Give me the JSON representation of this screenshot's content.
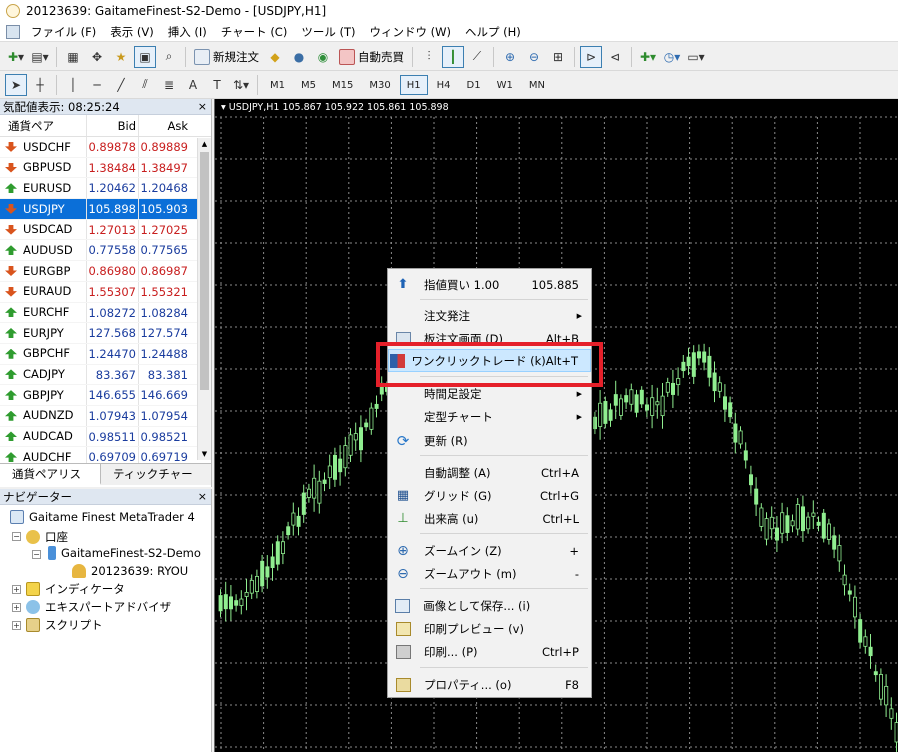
{
  "window": {
    "title": "20123639: GaitameFinest-S2-Demo - [USDJPY,H1]"
  },
  "menu": [
    "ファイル (F)",
    "表示 (V)",
    "挿入 (I)",
    "チャート (C)",
    "ツール (T)",
    "ウィンドウ (W)",
    "ヘルプ (H)"
  ],
  "toolbar": {
    "new_order": "新規注文",
    "auto_trade": "自動売買"
  },
  "timeframes": [
    "M1",
    "M5",
    "M15",
    "M30",
    "H1",
    "H4",
    "D1",
    "W1",
    "MN"
  ],
  "text_tools": {
    "text": "A",
    "label": "T"
  },
  "market_watch": {
    "title": "気配値表示: 08:25:24",
    "col_pair": "通貨ペア",
    "col_bid": "Bid",
    "col_ask": "Ask",
    "rows": [
      {
        "pair": "USDCHF",
        "bid": "0.89878",
        "ask": "0.89889",
        "dir": "dn"
      },
      {
        "pair": "GBPUSD",
        "bid": "1.38484",
        "ask": "1.38497",
        "dir": "dn"
      },
      {
        "pair": "EURUSD",
        "bid": "1.20462",
        "ask": "1.20468",
        "dir": "up"
      },
      {
        "pair": "USDJPY",
        "bid": "105.898",
        "ask": "105.903",
        "dir": "dn"
      },
      {
        "pair": "USDCAD",
        "bid": "1.27013",
        "ask": "1.27025",
        "dir": "dn"
      },
      {
        "pair": "AUDUSD",
        "bid": "0.77558",
        "ask": "0.77565",
        "dir": "up"
      },
      {
        "pair": "EURGBP",
        "bid": "0.86980",
        "ask": "0.86987",
        "dir": "dn"
      },
      {
        "pair": "EURAUD",
        "bid": "1.55307",
        "ask": "1.55321",
        "dir": "dn"
      },
      {
        "pair": "EURCHF",
        "bid": "1.08272",
        "ask": "1.08284",
        "dir": "up"
      },
      {
        "pair": "EURJPY",
        "bid": "127.568",
        "ask": "127.574",
        "dir": "up"
      },
      {
        "pair": "GBPCHF",
        "bid": "1.24470",
        "ask": "1.24488",
        "dir": "up"
      },
      {
        "pair": "CADJPY",
        "bid": "83.367",
        "ask": "83.381",
        "dir": "up"
      },
      {
        "pair": "GBPJPY",
        "bid": "146.655",
        "ask": "146.669",
        "dir": "up"
      },
      {
        "pair": "AUDNZD",
        "bid": "1.07943",
        "ask": "1.07954",
        "dir": "up"
      },
      {
        "pair": "AUDCAD",
        "bid": "0.98511",
        "ask": "0.98521",
        "dir": "up"
      },
      {
        "pair": "AUDCHF",
        "bid": "0.69709",
        "ask": "0.69719",
        "dir": "up"
      }
    ],
    "tab_pairs": "通貨ペアリスト",
    "tab_tick": "ティックチャート"
  },
  "navigator": {
    "title": "ナビゲーター",
    "root": "Gaitame Finest MetaTrader 4",
    "accounts": "口座",
    "server": "GaitameFinest-S2-Demo",
    "account": "20123639: RYOU",
    "indicators": "インディケータ",
    "experts": "エキスパートアドバイザ",
    "scripts": "スクリプト"
  },
  "chart": {
    "header": "USDJPY,H1  105.867 105.922 105.861 105.898"
  },
  "context_menu": {
    "items": [
      {
        "label": "指値買い 1.00",
        "shortcut": "105.885"
      },
      {
        "label": "注文発注",
        "shortcut": ""
      },
      {
        "label": "板注文画面 (D)",
        "shortcut": "Alt+B"
      },
      {
        "label": "ワンクリックトレード (k)",
        "shortcut": "Alt+T"
      },
      {
        "label": "時間足設定",
        "shortcut": ""
      },
      {
        "label": "定型チャート",
        "shortcut": ""
      },
      {
        "label": "更新 (R)",
        "shortcut": ""
      },
      {
        "label": "自動調整 (A)",
        "shortcut": "Ctrl+A"
      },
      {
        "label": "グリッド (G)",
        "shortcut": "Ctrl+G"
      },
      {
        "label": "出来高 (u)",
        "shortcut": "Ctrl+L"
      },
      {
        "label": "ズームイン (Z)",
        "shortcut": "+"
      },
      {
        "label": "ズームアウト (m)",
        "shortcut": "-"
      },
      {
        "label": "画像として保存... (i)",
        "shortcut": ""
      },
      {
        "label": "印刷プレビュー (v)",
        "shortcut": ""
      },
      {
        "label": "印刷... (P)",
        "shortcut": "Ctrl+P"
      },
      {
        "label": "プロパティ... (o)",
        "shortcut": "F8"
      }
    ]
  },
  "colors": {
    "candle": "#90ee90",
    "grid": "#8a8a8a",
    "highlight_box": "#e5202a",
    "selected_row": "#0b6fd8"
  }
}
